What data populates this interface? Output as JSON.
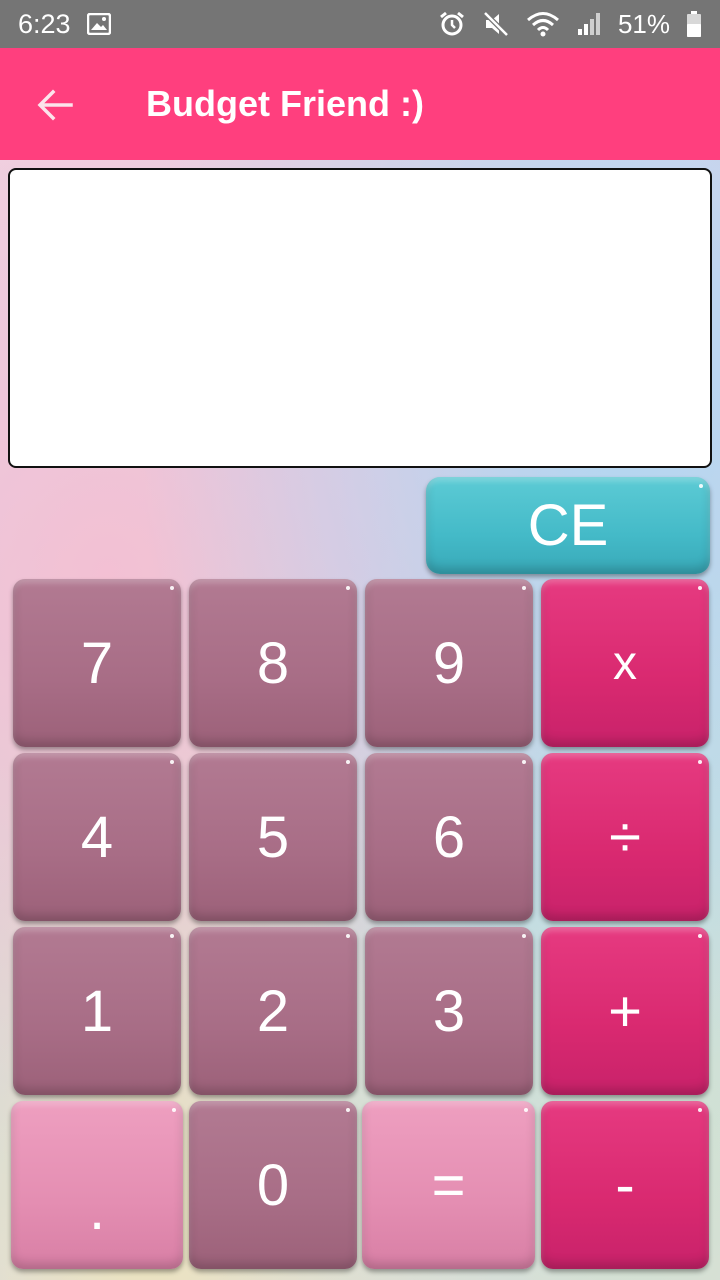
{
  "status_bar": {
    "time": "6:23",
    "battery": "51%",
    "icons": [
      "image-icon",
      "alarm-icon",
      "mute-icon",
      "wifi-icon",
      "signal-icon",
      "battery-icon"
    ]
  },
  "app_bar": {
    "title": "Budget Friend :)",
    "back_icon": "arrow-left-icon",
    "color": "#ff3f7e"
  },
  "display": {
    "value": ""
  },
  "keypad": {
    "clear": "CE",
    "keys": {
      "seven": "7",
      "eight": "8",
      "nine": "9",
      "multiply": "x",
      "four": "4",
      "five": "5",
      "six": "6",
      "divide": "÷",
      "one": "1",
      "two": "2",
      "three": "3",
      "add": "+",
      "decimal": ".",
      "zero": "0",
      "equals": "=",
      "subtract": "-"
    }
  },
  "colors": {
    "digit": "#a86d86",
    "operator": "#d92970",
    "light": "#e48eb2",
    "clear": "#44bac8",
    "status_bar": "#757575"
  }
}
